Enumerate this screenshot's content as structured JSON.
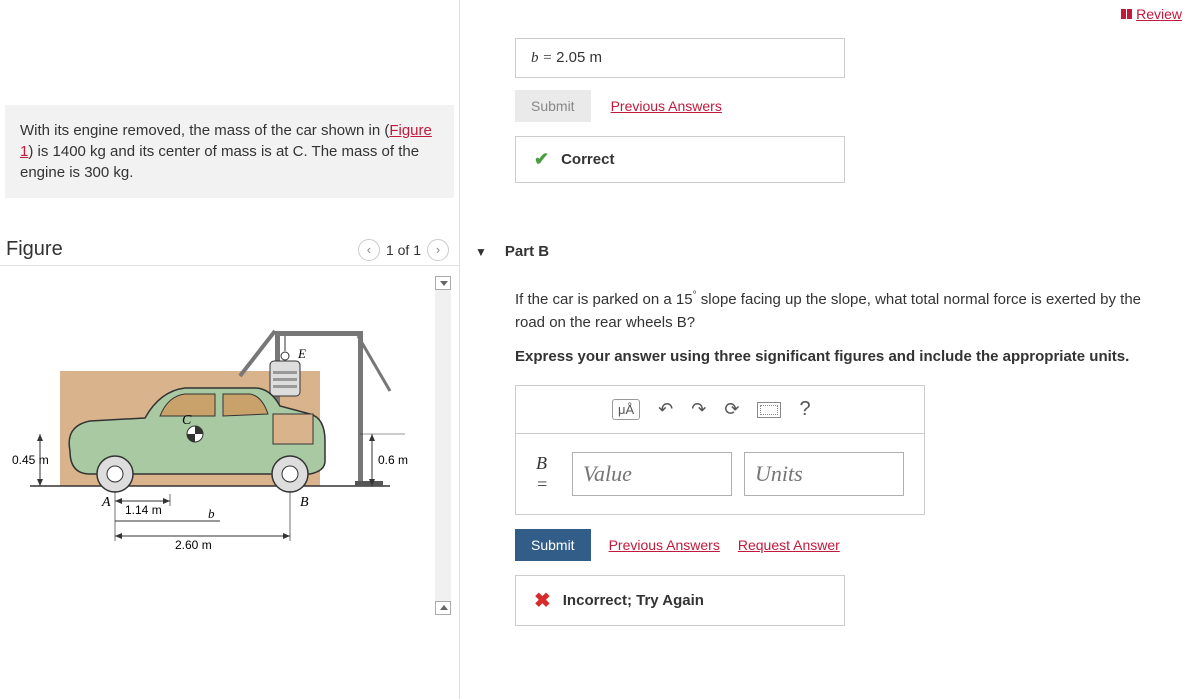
{
  "header": {
    "review": "Review"
  },
  "problem": {
    "text_before_link": "With its engine removed, the mass of the car shown in (",
    "figure_link": "Figure 1",
    "text_after_link": ") is 1400 kg and its center of mass is at C. The mass of the engine is 300 kg."
  },
  "figure": {
    "title": "Figure",
    "pager": "1 of 1",
    "labels": {
      "h_left": "0.45 m",
      "h_right": "0.6 m",
      "A": "A",
      "B": "B",
      "C": "C",
      "E": "E",
      "d_A": "1.14 m",
      "d_b": "b",
      "d_total": "2.60 m"
    }
  },
  "part_a_answer": {
    "prefix": "b = ",
    "value": "2.05 m"
  },
  "buttons": {
    "submit": "Submit",
    "previous_answers": "Previous Answers",
    "request_answer": "Request Answer"
  },
  "feedback": {
    "correct": "Correct",
    "incorrect": "Incorrect; Try Again"
  },
  "part_b": {
    "header": "Part B",
    "question_1": "If the car is parked on a 15",
    "question_deg": "°",
    "question_2": " slope facing up the slope, what total normal force is exerted by the road on the rear wheels B?",
    "instruction": "Express your answer using three significant figures and include the appropriate units.",
    "eq_label": "B =",
    "value_placeholder": "Value",
    "units_placeholder": "Units",
    "help": "?"
  }
}
